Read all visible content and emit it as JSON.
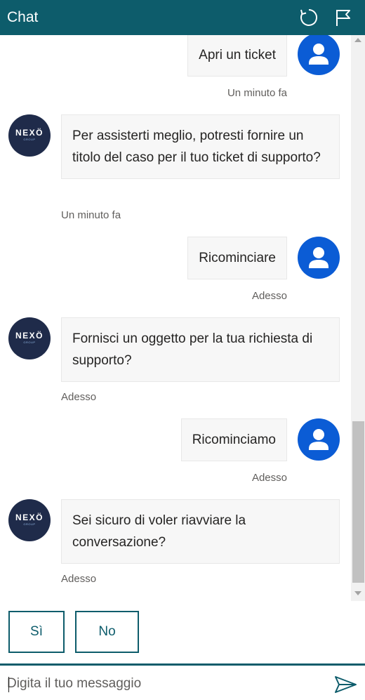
{
  "header": {
    "title": "Chat",
    "refresh_icon": "refresh-icon",
    "flag_icon": "flag-icon"
  },
  "colors": {
    "header_bg": "#0d5c6b",
    "user_avatar": "#0b5cd5",
    "bot_avatar": "#1f2b4a",
    "bubble_bg": "#f7f7f7"
  },
  "bot": {
    "avatar_logo": "NEXÖ",
    "avatar_sub": "GROUP"
  },
  "messages": [
    {
      "from": "user",
      "text": "Apri un ticket",
      "time": "Un minuto fa"
    },
    {
      "from": "bot",
      "text": "Per assisterti meglio, potresti fornire un titolo del caso per il tuo ticket di supporto?",
      "time": "Un minuto fa"
    },
    {
      "from": "user",
      "text": "Ricominciare",
      "time": "Adesso"
    },
    {
      "from": "bot",
      "text": "Fornisci un oggetto per la tua richiesta di supporto?",
      "time": "Adesso"
    },
    {
      "from": "user",
      "text": "Ricominciamo",
      "time": "Adesso"
    },
    {
      "from": "bot",
      "text": "Sei sicuro di voler riavviare la conversazione?",
      "time": "Adesso"
    }
  ],
  "suggested_actions": [
    {
      "label": "Sì"
    },
    {
      "label": "No"
    }
  ],
  "input": {
    "placeholder": "Digita il tuo messaggio",
    "value": "",
    "send_icon": "send-icon"
  }
}
